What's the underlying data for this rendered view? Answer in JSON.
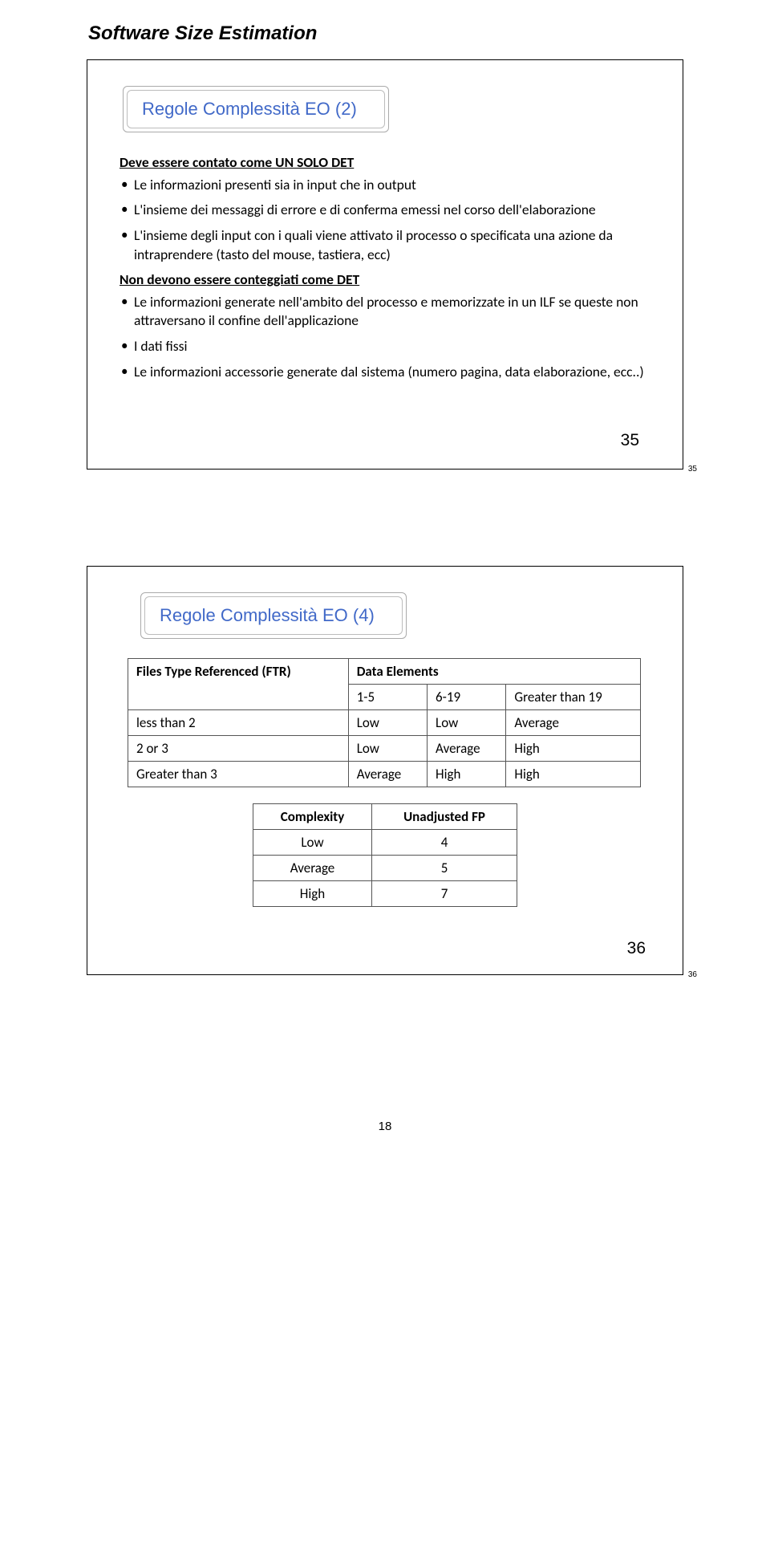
{
  "header": {
    "title": "Software Size Estimation"
  },
  "slide1": {
    "title": "Regole Complessità EO (2)",
    "section1_head": "Deve essere contato come UN SOLO DET",
    "section1_items": [
      "Le informazioni presenti sia in input che in output",
      "L'insieme dei messaggi di errore e di conferma emessi nel corso dell'elaborazione",
      "L'insieme degli input con i quali viene attivato il processo o specificata una azione da intraprendere (tasto del mouse, tastiera, ecc)"
    ],
    "section2_head": "Non devono essere conteggiati come DET",
    "section2_items": [
      "Le informazioni generate nell'ambito del processo e memorizzate in un ILF se queste non attraversano il confine dell'applicazione",
      "I dati fissi",
      "Le informazioni accessorie generate dal sistema (numero pagina, data elaborazione, ecc..)"
    ],
    "slide_num": "35",
    "tiny_num": "35"
  },
  "slide2": {
    "title": "Regole Complessità EO (4)",
    "main_table": {
      "ftr_header": "Files Type Referenced (FTR)",
      "de_header": "Data Elements",
      "cols": [
        "1-5",
        "6-19",
        "Greater than 19"
      ],
      "rows": [
        {
          "ftr": "less than 2",
          "cells": [
            "Low",
            "Low",
            "Average"
          ]
        },
        {
          "ftr": "2 or 3",
          "cells": [
            "Low",
            "Average",
            "High"
          ]
        },
        {
          "ftr": "Greater than 3",
          "cells": [
            "Average",
            "High",
            "High"
          ]
        }
      ]
    },
    "fp_table": {
      "headers": [
        "Complexity",
        "Unadjusted FP"
      ],
      "rows": [
        [
          "Low",
          "4"
        ],
        [
          "Average",
          "5"
        ],
        [
          "High",
          "7"
        ]
      ]
    },
    "slide_num": "36",
    "tiny_num": "36"
  },
  "footer": {
    "page": "18"
  }
}
